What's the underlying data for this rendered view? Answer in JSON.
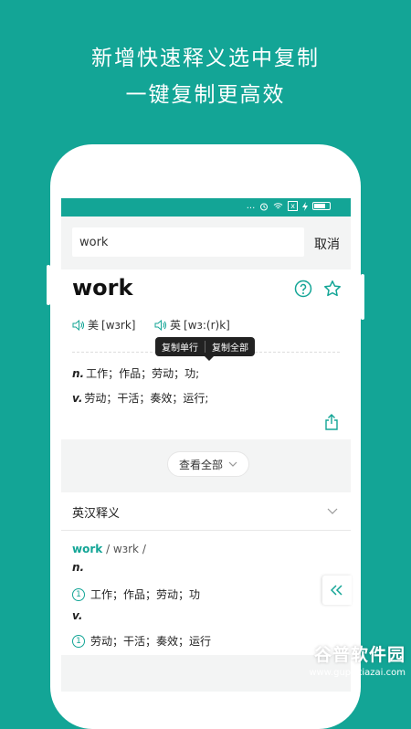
{
  "headline": {
    "line1": "新增快速释义选中复制",
    "line2": "一键复制更高效"
  },
  "statusbar": {
    "dots": "...",
    "x_badge": "x"
  },
  "search": {
    "value": "work",
    "cancel_label": "取消"
  },
  "entry": {
    "word": "work",
    "phonetics": [
      {
        "lang": "美",
        "ipa": "[wɜrk]"
      },
      {
        "lang": "英",
        "ipa": "[wɜ:(r)k]"
      }
    ],
    "copy_menu": {
      "copy_line": "复制单行",
      "copy_all": "复制全部"
    },
    "definitions": [
      {
        "pos": "n.",
        "text": "工作；作品；劳动；功;"
      },
      {
        "pos": "v.",
        "text": "劳动；干活；奏效；运行;"
      }
    ],
    "view_all_label": "查看全部"
  },
  "section": {
    "title": "英汉释义",
    "word": "work",
    "phonetic": "/ wɜrk /",
    "senses": [
      {
        "pos": "n.",
        "num": "1",
        "text": "工作；作品；劳动；功"
      },
      {
        "pos": "v.",
        "num": "1",
        "text": "劳动；干活；奏效；运行"
      }
    ]
  },
  "watermark": {
    "brand": "谷普软件园",
    "url": "www.gupuxiazai.com"
  },
  "colors": {
    "accent": "#13a596",
    "band": "#f3f4f4"
  }
}
